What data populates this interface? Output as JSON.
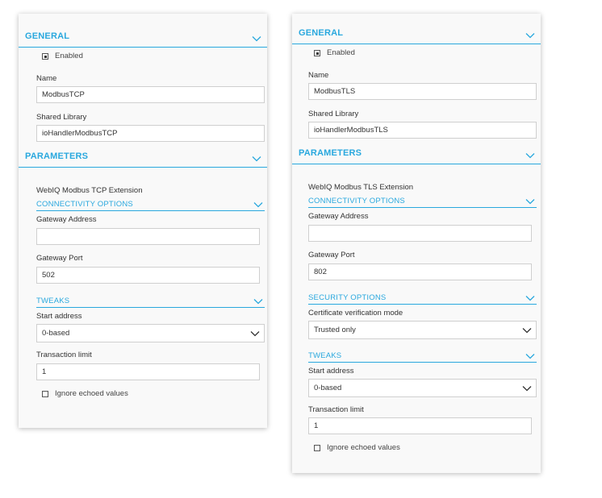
{
  "panels": [
    {
      "general": {
        "title": "GENERAL",
        "enabled_label": "Enabled",
        "enabled": true,
        "name_label": "Name",
        "name_value": "ModbusTCP",
        "library_label": "Shared Library",
        "library_value": "ioHandlerModbusTCP"
      },
      "parameters": {
        "title": "PARAMETERS",
        "extension_text": "WebIQ Modbus TCP Extension",
        "connectivity": {
          "title": "CONNECTIVITY OPTIONS",
          "address_label": "Gateway Address",
          "address_value": "",
          "port_label": "Gateway Port",
          "port_value": "502"
        },
        "tweaks": {
          "title": "TWEAKS",
          "start_label": "Start address",
          "start_value": "0-based",
          "limit_label": "Transaction limit",
          "limit_value": "1",
          "ignore_label": "Ignore echoed values",
          "ignore_checked": false
        }
      }
    },
    {
      "general": {
        "title": "GENERAL",
        "enabled_label": "Enabled",
        "enabled": true,
        "name_label": "Name",
        "name_value": "ModbusTLS",
        "library_label": "Shared Library",
        "library_value": "ioHandlerModbusTLS"
      },
      "parameters": {
        "title": "PARAMETERS",
        "extension_text": "WebIQ Modbus TLS Extension",
        "connectivity": {
          "title": "CONNECTIVITY OPTIONS",
          "address_label": "Gateway Address",
          "address_value": "",
          "port_label": "Gateway Port",
          "port_value": "802"
        },
        "security": {
          "title": "SECURITY OPTIONS",
          "cert_label": "Certificate verification mode",
          "cert_value": "Trusted only"
        },
        "tweaks": {
          "title": "TWEAKS",
          "start_label": "Start address",
          "start_value": "0-based",
          "limit_label": "Transaction limit",
          "limit_value": "1",
          "ignore_label": "Ignore echoed values",
          "ignore_checked": false
        }
      }
    }
  ],
  "colors": {
    "accent": "#29a8de",
    "panel_bg": "#f9f9f9",
    "field_border": "#cfcfcf",
    "text": "#333333"
  }
}
